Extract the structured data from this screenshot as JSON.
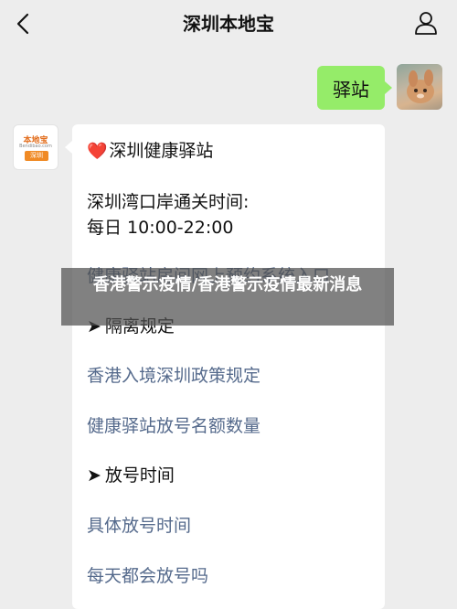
{
  "header": {
    "title": "深圳本地宝",
    "back_icon": "chevron-left-icon",
    "profile_icon": "person-icon"
  },
  "outgoing": {
    "text": "驿站"
  },
  "incoming": {
    "avatar": {
      "brand": "本地宝",
      "url": "Bendibao.com",
      "city": "深圳"
    },
    "card": {
      "title": "深圳健康驿站",
      "line1": "深圳湾口岸通关时间:",
      "line2": "每日 10:00-22:00",
      "link_booking": "健康驿站房间网上预约系统入口",
      "section_isolation": "隔离规定",
      "link_hk_entry": "香港入境深圳政策规定",
      "link_quota": "健康驿站放号名额数量",
      "section_release": "放号时间",
      "link_release_time": "具体放号时间",
      "link_daily_release": "每天都会放号吗"
    }
  },
  "overlay": {
    "headline": "香港警示疫情/香港警示疫情最新消息"
  },
  "colors": {
    "background": "#ededed",
    "bubble_out": "#95ec69",
    "link": "#556a8c",
    "heart": "#e0282e"
  }
}
